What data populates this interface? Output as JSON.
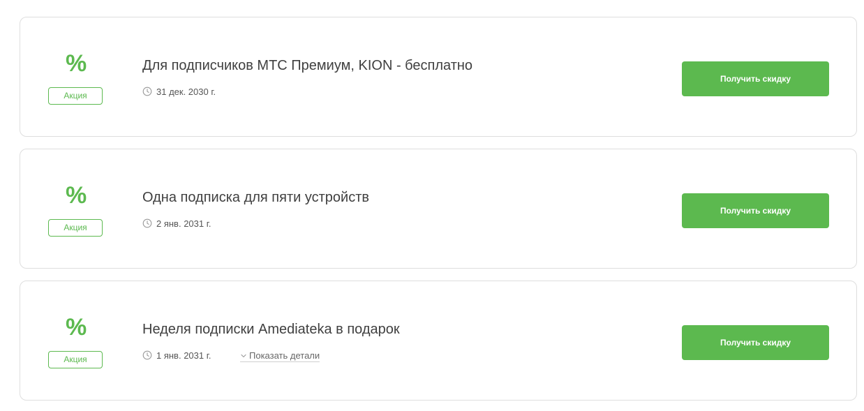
{
  "colors": {
    "accent": "#5cb94f",
    "border": "#dedede",
    "text": "#3f3f3f"
  },
  "icons": {
    "percent": "percent-icon",
    "clock": "clock-icon",
    "chevron": "chevron-down-icon"
  },
  "offers": [
    {
      "icon_glyph": "%",
      "badge": "Акция",
      "title": "Для подписчиков МТС Премиум, KION - бесплатно",
      "date": "31 дек. 2030 г.",
      "button": "Получить скидку"
    },
    {
      "icon_glyph": "%",
      "badge": "Акция",
      "title": "Одна подписка для пяти устройств",
      "date": "2 янв. 2031 г.",
      "button": "Получить скидку"
    },
    {
      "icon_glyph": "%",
      "badge": "Акция",
      "title": "Неделя подписки Amediateka в подарок",
      "date": "1 янв. 2031 г.",
      "details": "Показать детали",
      "button": "Получить скидку"
    }
  ]
}
